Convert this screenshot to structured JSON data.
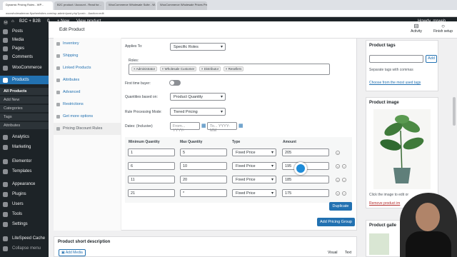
{
  "browser": {
    "tabs": [
      "Dynamic Pricing Rules - WP...",
      "B2C product / Account - Read for...",
      "WooCommerce Wholesale Suite - W...",
      "WooCommerce Wholesale Prices Pre..."
    ],
    "url": "woowholesalemax.flywheelsites.com/wp-admin/post.php?post=...&action=edit"
  },
  "adminbar": {
    "site": "B2C + B2B",
    "comments": "0",
    "new": "+ New",
    "view": "View product",
    "howdy": "Howdy, mrweb"
  },
  "sidebar": {
    "items": [
      "Posts",
      "Media",
      "Pages",
      "Comments",
      "WooCommerce",
      "Products",
      "Analytics",
      "Marketing",
      "Elementor",
      "Templates",
      "Appearance",
      "Plugins",
      "Users",
      "Tools",
      "Settings",
      "LiteSpeed Cache",
      "Collapse menu"
    ],
    "sub": [
      "All Products",
      "Add New",
      "Categories",
      "Tags",
      "Attributes"
    ]
  },
  "header": {
    "title": "Edit Product",
    "activity": "Activity",
    "finish": "Finish setup"
  },
  "product_tabs": [
    "Inventory",
    "Shipping",
    "Linked Products",
    "Attributes",
    "Advanced",
    "Restrictions",
    "Get more options",
    "Pricing Discount Rules"
  ],
  "rule": {
    "applies_to_label": "Applies To:",
    "applies_to": "Specific Roles",
    "roles_label": "Roles:",
    "roles": [
      "× Administrator",
      "× Wholesale Customer",
      "× Distributor",
      "× Resellers"
    ],
    "first_time_label": "First time buyer:",
    "qty_based_label": "Quantities based on:",
    "qty_based": "Product Quantity",
    "mode_label": "Rule Processing Mode:",
    "mode": "Tiered Pricing",
    "dates_label": "Dates: (Inclusive)",
    "from_ph": "From... YYYY-",
    "to_ph": "To... YYYY-MM",
    "headers": [
      "Minimum Quantity",
      "Max Quantity",
      "Type",
      "Amount"
    ],
    "rows": [
      {
        "min": "1",
        "max": "5",
        "type": "Fixed Price",
        "amount": "205"
      },
      {
        "min": "6",
        "max": "10",
        "type": "Fixed Price",
        "amount": "195"
      },
      {
        "min": "11",
        "max": "20",
        "type": "Fixed Price",
        "amount": "185"
      },
      {
        "min": "21",
        "max": "*",
        "type": "Fixed Price",
        "amount": "175"
      }
    ],
    "duplicate": "Duplicate",
    "add_group": "Add Pricing Group"
  },
  "short_desc": {
    "title": "Product short description",
    "add_media": "Add Media",
    "visual": "Visual",
    "text": "Text"
  },
  "tags": {
    "title": "Product tags",
    "add": "Add",
    "hint": "Separate tags with commas",
    "link": "Choose from the most used tags"
  },
  "image": {
    "title": "Product image",
    "hint": "Click the image to edit or",
    "remove": "Remove product im"
  },
  "gallery": {
    "title": "Product galle"
  }
}
